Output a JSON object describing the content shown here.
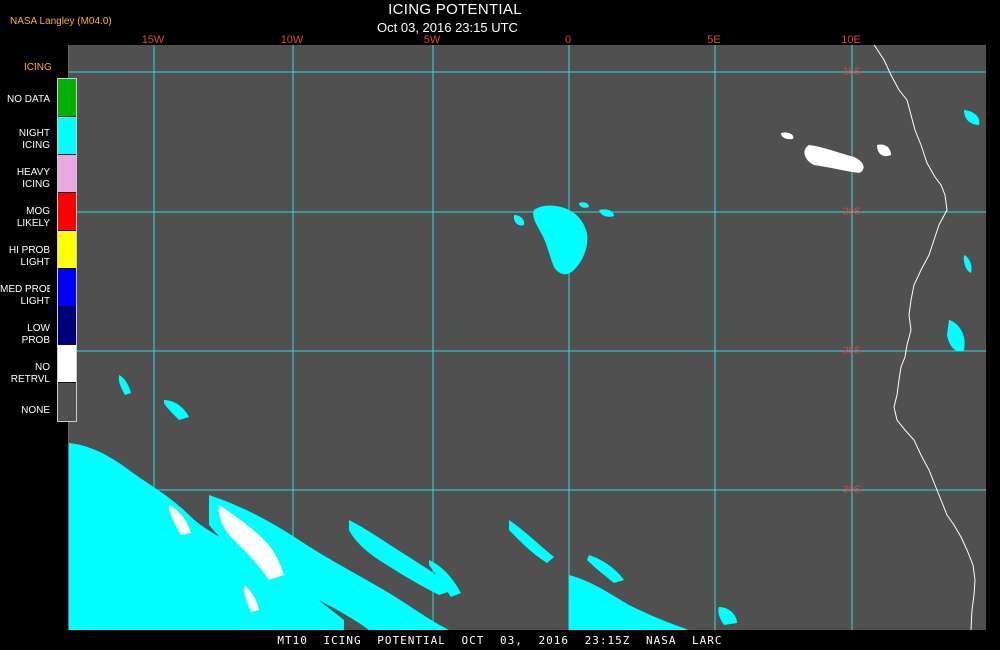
{
  "header": {
    "title": "ICING POTENTIAL",
    "subtitle": "Oct 03, 2016 23:15 UTC",
    "agency": "NASA Langley (M04.0)"
  },
  "legend": {
    "title": "ICING",
    "items": [
      {
        "label": "NO DATA",
        "color": "#00b000"
      },
      {
        "label": "NIGHT\nICING",
        "color": "#00ffff"
      },
      {
        "label": "HEAVY\nICING",
        "color": "#e8a8e0"
      },
      {
        "label": "MOG\nLIKELY",
        "color": "#ff0000"
      },
      {
        "label": "HI PROB\nLIGHT",
        "color": "#ffff00"
      },
      {
        "label": "MED PROB\nLIGHT",
        "color": "#0000ff"
      },
      {
        "label": "LOW\nPROB",
        "color": "#00007a"
      },
      {
        "label": "NO\nRETRVL",
        "color": "#ffffff"
      },
      {
        "label": "NONE",
        "color": "#505050"
      }
    ]
  },
  "map": {
    "longitude_labels": [
      "15W",
      "10W",
      "5W",
      "0",
      "5E",
      "10E"
    ],
    "latitude_labels": [
      "15S",
      "20S",
      "25S",
      "30S"
    ],
    "grid_color": "#35d8e0",
    "coast_color": "#ffffff"
  },
  "footer": {
    "text": "MT10   ICING POTENTIAL   OCT 03, 2016 23:15Z   NASA LARC"
  }
}
